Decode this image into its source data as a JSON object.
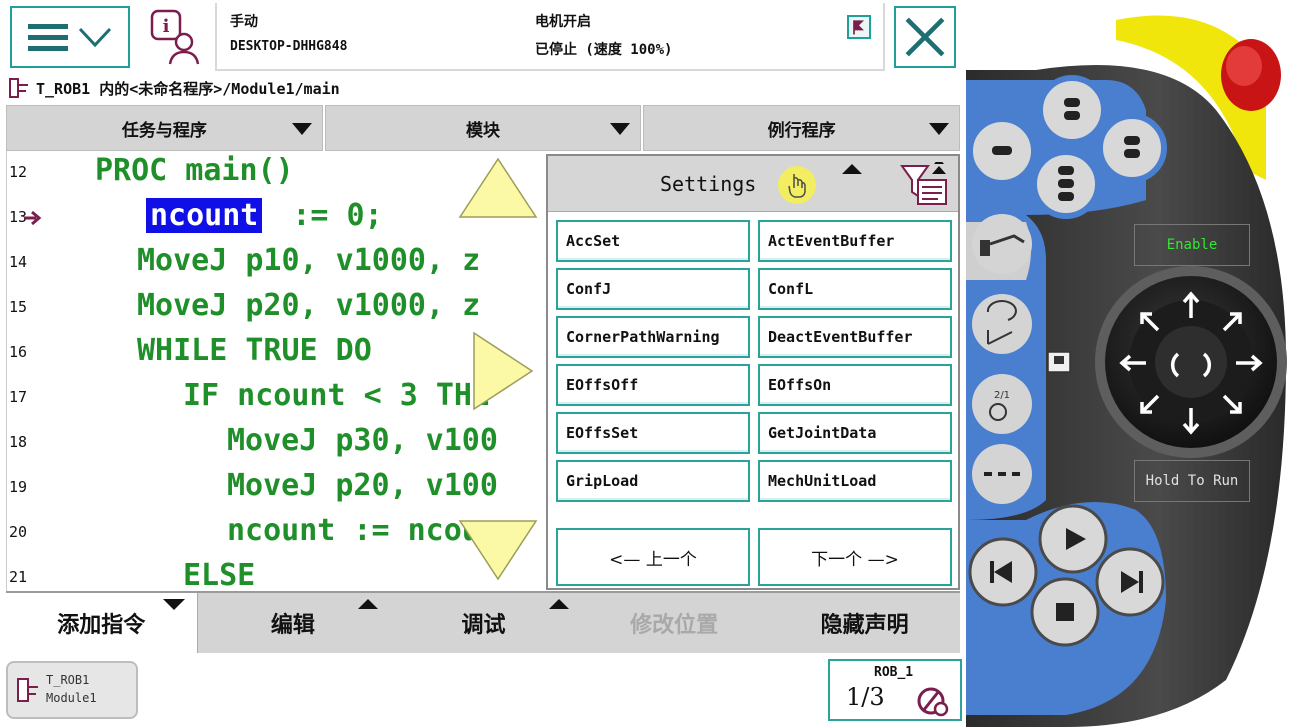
{
  "status": {
    "mode": "手动",
    "host": "DESKTOP-DHHG848",
    "motors": "电机开启",
    "state": "已停止 (速度 100%)"
  },
  "breadcrumb": "T_ROB1 内的<未命名程序>/Module1/main",
  "selectors": [
    "任务与程序",
    "模块",
    "例行程序"
  ],
  "code": [
    {
      "ln": "12",
      "text": "PROC main()"
    },
    {
      "ln": "13",
      "text": "ncount",
      "rest": ":= 0;"
    },
    {
      "ln": "14",
      "text": "MoveJ p10, v1000, z"
    },
    {
      "ln": "15",
      "text": "MoveJ p20, v1000, z"
    },
    {
      "ln": "16",
      "text": "WHILE TRUE DO"
    },
    {
      "ln": "17",
      "text": "IF ncount < 3 THE"
    },
    {
      "ln": "18",
      "text": "MoveJ p30, v100"
    },
    {
      "ln": "19",
      "text": "MoveJ p20, v100"
    },
    {
      "ln": "20",
      "text": "ncount := ncoun"
    },
    {
      "ln": "21",
      "text": "ELSE"
    }
  ],
  "popup": {
    "title": "Settings",
    "instructions": [
      "AccSet",
      "ActEventBuffer",
      "ConfJ",
      "ConfL",
      "CornerPathWarning",
      "DeactEventBuffer",
      "EOffsOff",
      "EOffsOn",
      "EOffsSet",
      "GetJointData",
      "GripLoad",
      "MechUnitLoad"
    ],
    "prev": "<—  上一个",
    "next": "下一个  —>"
  },
  "commands": {
    "add": "添加指令",
    "edit": "编辑",
    "debug": "调试",
    "modify": "修改位置",
    "hide": "隐藏声明"
  },
  "taskbar": {
    "task_line1": "T_ROB1",
    "task_line2": "Module1",
    "rob_label": "ROB_1",
    "rob_fraction": "1/3"
  },
  "hardware": {
    "enable_label": "Enable",
    "hold_label": "Hold To Run"
  },
  "colors": {
    "accent": "#1f9f98",
    "code": "#1f8f2a",
    "selection": "#1010e6",
    "pendant_blue": "#4a7fd0"
  }
}
